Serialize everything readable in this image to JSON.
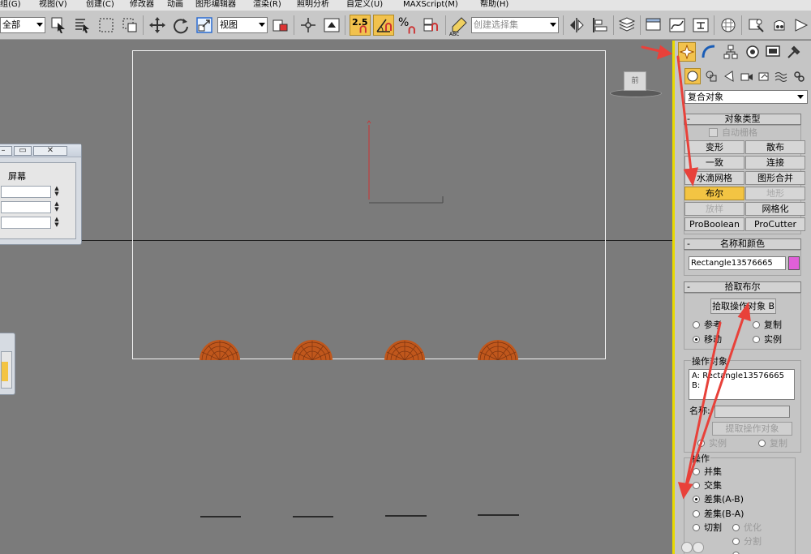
{
  "menu": {
    "items": [
      "组(G)",
      "视图(V)",
      "创建(C)",
      "修改器",
      "动画",
      "图形编辑器",
      "渲染(R)",
      "照明分析",
      "自定义(U)",
      "MAXScript(M)",
      "帮助(H)"
    ]
  },
  "toolbar": {
    "selection_filter": "全部",
    "ref_coord": "视图",
    "snap_label": "2.5",
    "percent_label": "%",
    "named_selection_placeholder": "创建选择集",
    "abc_label": "ABC"
  },
  "viewport": {
    "viewcube_label": "前"
  },
  "dialog_top": {
    "close": "✕",
    "group_label": "屏幕"
  },
  "panel": {
    "category": "复合对象",
    "object_type": {
      "title": "对象类型",
      "autogrid": "自动栅格",
      "buttons": [
        "变形",
        "散布",
        "一致",
        "连接",
        "水滴网格",
        "图形合并",
        "布尔",
        "地形",
        "放样",
        "网格化",
        "ProBoolean",
        "ProCutter"
      ]
    },
    "name_color": {
      "title": "名称和颜色",
      "name": "Rectangle13576665",
      "swatch_color": "#e060d8"
    },
    "pick_boolean": {
      "title": "拾取布尔",
      "pick_button": "拾取操作对象 B",
      "reference": "参考",
      "copy": "复制",
      "move": "移动",
      "instance": "实例"
    },
    "operands": {
      "title": "操作对象",
      "a": "A: Rectangle13576665",
      "b": "B:",
      "name_label": "名称:",
      "extract_button": "提取操作对象",
      "instance": "实例",
      "copy": "复制"
    },
    "operation": {
      "title": "操作",
      "union": "并集",
      "intersection": "交集",
      "subtract_ab": "差集(A-B)",
      "subtract_ba": "差集(B-A)",
      "cut": "切割",
      "refine": "优化",
      "split": "分割"
    }
  },
  "colors": {
    "viewport_bg": "#7b7b7b",
    "active_viewport_border": "#e8d900",
    "active_button": "#f3c443",
    "annotation_arrow": "#e8413a",
    "pebble": "#c0571c"
  }
}
